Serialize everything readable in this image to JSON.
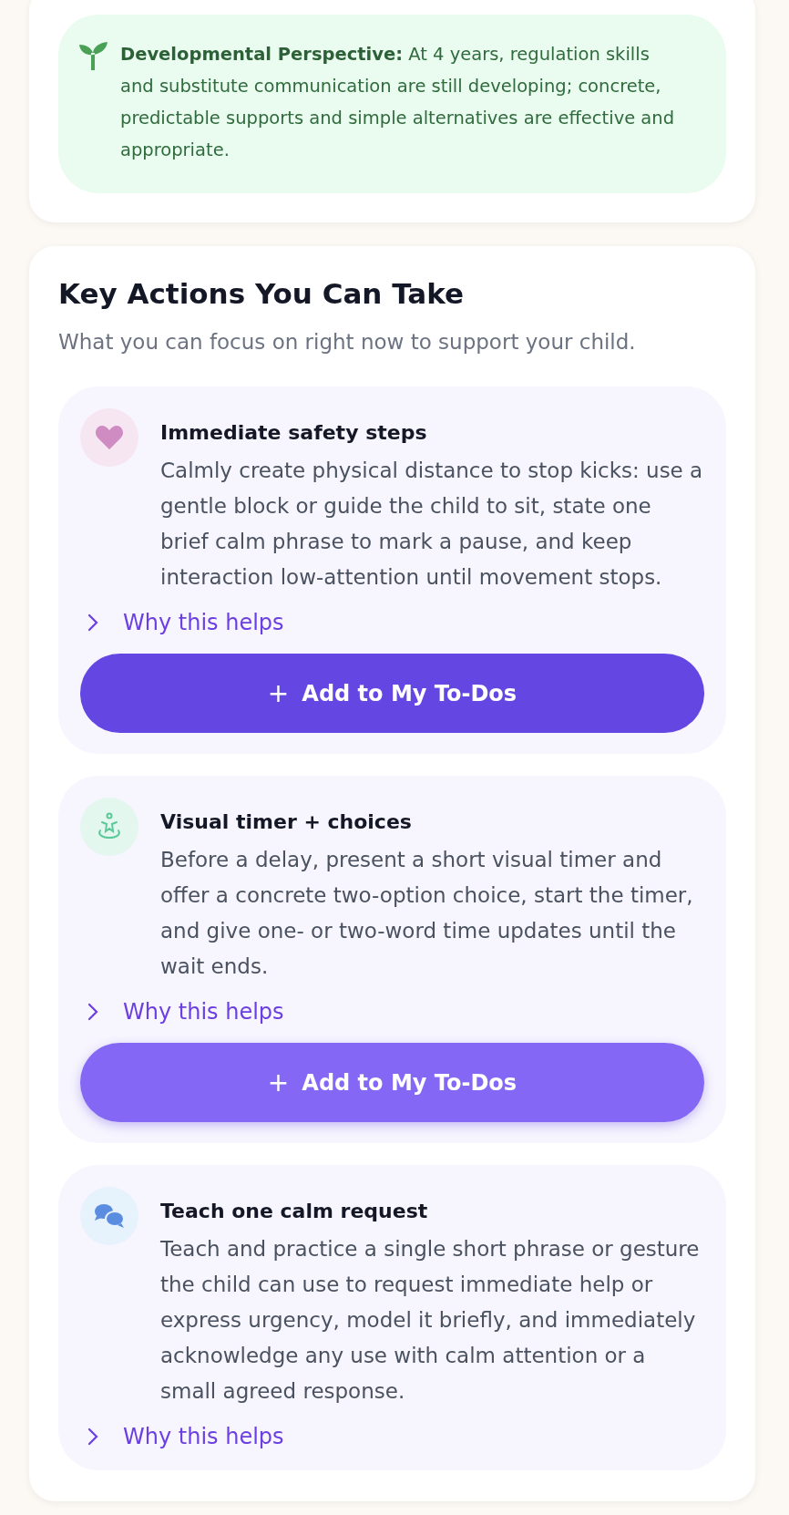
{
  "perspective": {
    "text": "**Developmental Perspective:** At 4 years, regulation skills and substitute communication are still developing; concrete, predictable supports and simple alternatives are effective and appropriate."
  },
  "key_actions": {
    "title": "Key Actions You Can Take",
    "subtitle": "What you can focus on right now to support your child.",
    "actions": [
      {
        "kind": "heart",
        "title": "Immediate safety steps",
        "body": "Calmly create physical distance to stop kicks: use a gentle block or guide the child to sit, state one brief calm phrase to mark a pause, and keep interaction low-attention until movement stops.",
        "why": "Why this helps",
        "expanded": false,
        "button": {
          "icon": "+",
          "label": "Add to My To-Dos",
          "hovered": false
        }
      },
      {
        "kind": "figure",
        "title": "Visual timer + choices",
        "body": "Before a delay, present a short visual timer and offer a concrete two-option choice, start the timer, and give one- or two-word time updates until the wait ends.",
        "why": "Why this helps",
        "expanded": false,
        "button": {
          "icon": "+",
          "label": "Add to My To-Dos",
          "hovered": true
        }
      },
      {
        "kind": "chat",
        "title": "Teach one calm request",
        "body": "Teach and practice a single short phrase or gesture the child can use to request immediate help or express urgency, model it briefly, and immediately acknowledge any use with calm attention or a small agreed response.",
        "why": "Why this helps",
        "expanded": false
      }
    ]
  }
}
